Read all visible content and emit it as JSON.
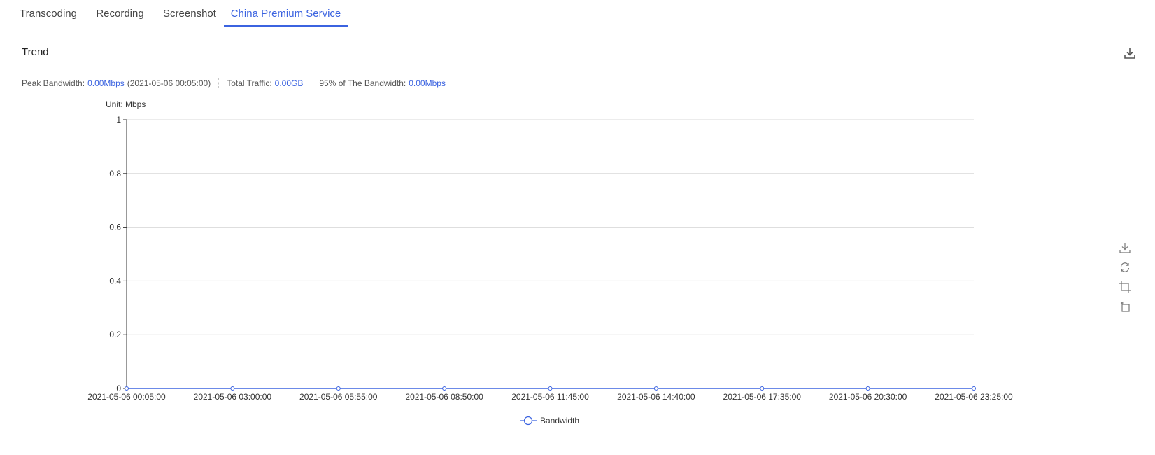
{
  "tabs": [
    {
      "label": "Transcoding",
      "active": false
    },
    {
      "label": "Recording",
      "active": false
    },
    {
      "label": "Screenshot",
      "active": false
    },
    {
      "label": "China Premium Service",
      "active": true
    }
  ],
  "section": {
    "title": "Trend",
    "export_icon": "download-icon"
  },
  "summary": {
    "peak_label": "Peak Bandwidth:",
    "peak_value": "0.00Mbps",
    "peak_time": "(2021-05-06 00:05:00)",
    "traffic_label": "Total Traffic:",
    "traffic_value": "0.00GB",
    "p95_label": "95% of The Bandwidth:",
    "p95_value": "0.00Mbps"
  },
  "colors": {
    "accent": "#3b63e0",
    "grid": "#d9d9d9",
    "axis": "#333333"
  },
  "toolbox": [
    {
      "name": "save-image-icon"
    },
    {
      "name": "restore-icon"
    },
    {
      "name": "zoom-icon"
    },
    {
      "name": "zoom-reset-icon"
    }
  ],
  "chart_data": {
    "type": "line",
    "unit_label": "Unit: Mbps",
    "x": [
      "2021-05-06 00:05:00",
      "2021-05-06 03:00:00",
      "2021-05-06 05:55:00",
      "2021-05-06 08:50:00",
      "2021-05-06 11:45:00",
      "2021-05-06 14:40:00",
      "2021-05-06 17:35:00",
      "2021-05-06 20:30:00",
      "2021-05-06 23:25:00"
    ],
    "series": [
      {
        "name": "Bandwidth",
        "values": [
          0,
          0,
          0,
          0,
          0,
          0,
          0,
          0,
          0
        ],
        "color": "#3b63e0"
      }
    ],
    "ylim": [
      0,
      1
    ],
    "yticks": [
      0,
      0.2,
      0.4,
      0.6,
      0.8,
      1
    ],
    "ytick_labels": [
      "0",
      "0.2",
      "0.4",
      "0.6",
      "0.8",
      "1"
    ],
    "grid": true,
    "legend_position": "bottom-center"
  }
}
